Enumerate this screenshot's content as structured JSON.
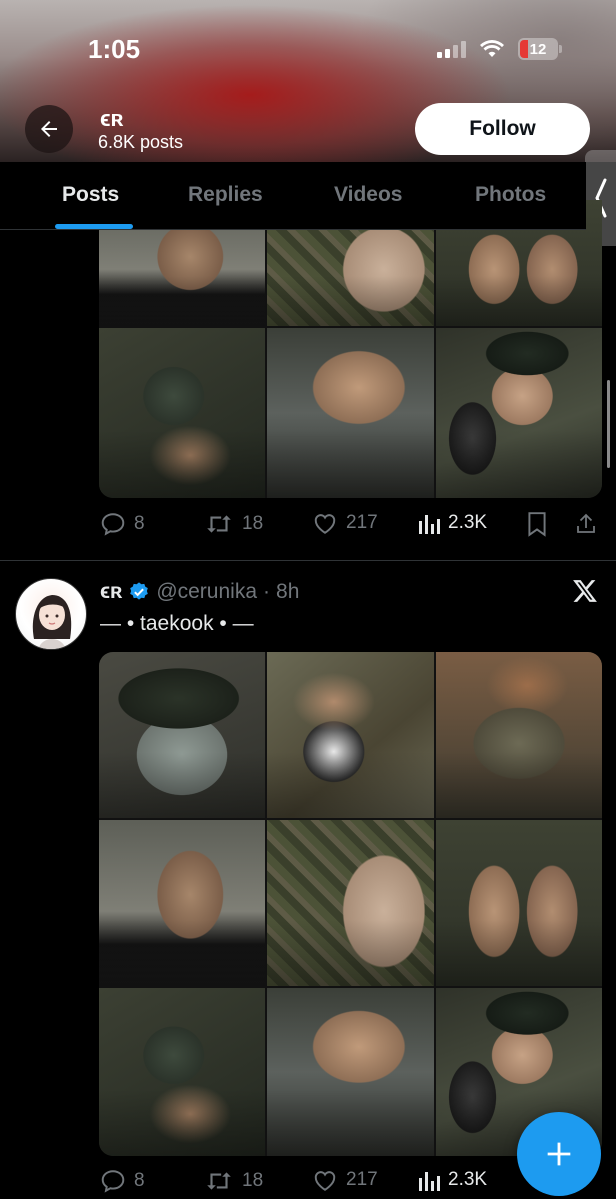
{
  "status_bar": {
    "time": "1:05",
    "battery": "12"
  },
  "profile": {
    "name": "ϵʀ",
    "post_count": "6.8K posts",
    "follow_label": "Follow"
  },
  "tabs": [
    {
      "label": "Posts",
      "active": true
    },
    {
      "label": "Replies",
      "active": false
    },
    {
      "label": "Videos",
      "active": false
    },
    {
      "label": "Photos",
      "active": false
    }
  ],
  "posts": [
    {
      "images": [
        "torso",
        "belly",
        "legs",
        "glove",
        "water",
        "selfie"
      ],
      "stats": {
        "replies": "8",
        "reposts": "18",
        "likes": "217",
        "views": "2.3K"
      }
    },
    {
      "author_name": "ϵʀ",
      "verified": true,
      "handle": "@cerunika",
      "separator": "·",
      "time": "8h",
      "text": "— • taekook • —",
      "images": [
        "beret",
        "hands",
        "sitting",
        "torso",
        "belly",
        "legs",
        "glove",
        "water",
        "selfie"
      ],
      "stats": {
        "replies": "8",
        "reposts": "18",
        "likes": "217",
        "views": "2.3K"
      }
    }
  ],
  "colors": {
    "accent": "#1d9bf0",
    "background": "#000000",
    "muted_text": "#71767b",
    "primary_text": "#e7e9ea",
    "battery_low": "#e53935"
  },
  "icons": [
    "back-arrow-icon",
    "wifi-icon",
    "signal-icon",
    "battery-icon",
    "reply-icon",
    "repost-icon",
    "like-icon",
    "views-icon",
    "bookmark-icon",
    "share-icon",
    "verified-icon",
    "x-logo-icon",
    "compose-plus-icon",
    "chevron-left-icon"
  ]
}
